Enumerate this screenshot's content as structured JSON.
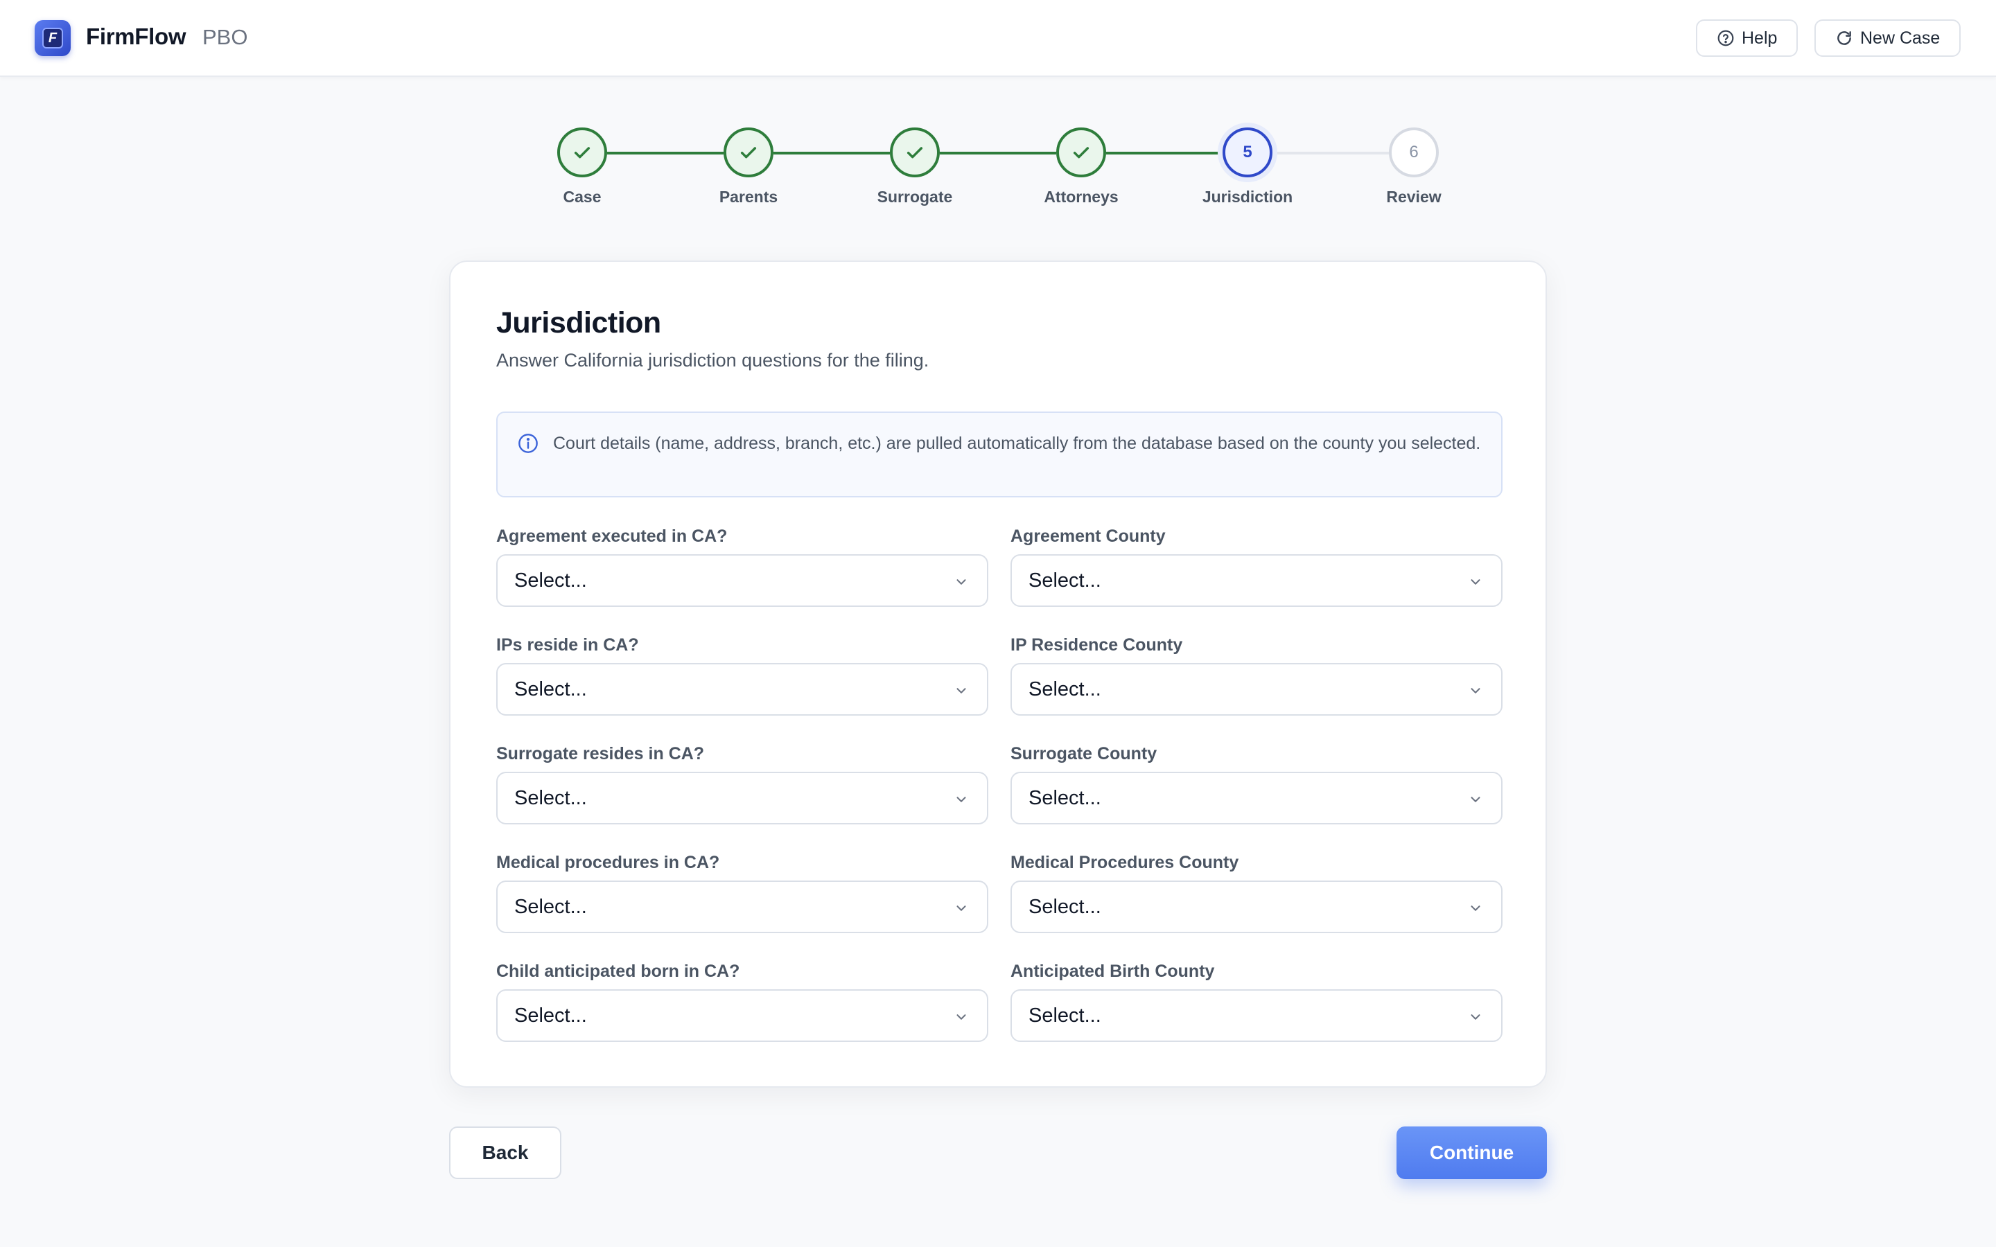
{
  "app": {
    "name": "FirmFlow",
    "suffix": "PBO",
    "logo_icon": "firmflow-logo-icon"
  },
  "header": {
    "help_label": "Help",
    "help_icon": "help-circle-icon",
    "new_case_label": "New Case",
    "new_case_icon": "refresh-icon"
  },
  "stepper": {
    "steps": [
      {
        "label": "Case",
        "status": "complete"
      },
      {
        "label": "Parents",
        "status": "complete"
      },
      {
        "label": "Surrogate",
        "status": "complete"
      },
      {
        "label": "Attorneys",
        "status": "complete"
      },
      {
        "label": "Jurisdiction",
        "status": "active",
        "number": "5"
      },
      {
        "label": "Review",
        "status": "pending",
        "number": "6"
      }
    ]
  },
  "form": {
    "title": "Jurisdiction",
    "subtitle": "Answer California jurisdiction questions for the filing.",
    "info_text": "Court details (name, address, branch, etc.) are pulled automatically from the database based on the county you selected.",
    "fields": [
      {
        "label": "Agreement executed in CA?",
        "value": "Select..."
      },
      {
        "label": "Agreement County",
        "value": "Select..."
      },
      {
        "label": "IPs reside in CA?",
        "value": "Select..."
      },
      {
        "label": "IP Residence County",
        "value": "Select..."
      },
      {
        "label": "Surrogate resides in CA?",
        "value": "Select..."
      },
      {
        "label": "Surrogate County",
        "value": "Select..."
      },
      {
        "label": "Medical procedures in CA?",
        "value": "Select..."
      },
      {
        "label": "Medical Procedures County",
        "value": "Select..."
      },
      {
        "label": "Child anticipated born in CA?",
        "value": "Select..."
      },
      {
        "label": "Anticipated Birth County",
        "value": "Select..."
      }
    ]
  },
  "footer": {
    "back_label": "Back",
    "continue_label": "Continue"
  },
  "colors": {
    "complete": "#2e7d3b",
    "active": "#2f49c9",
    "primary_button": "#5b85f3"
  }
}
